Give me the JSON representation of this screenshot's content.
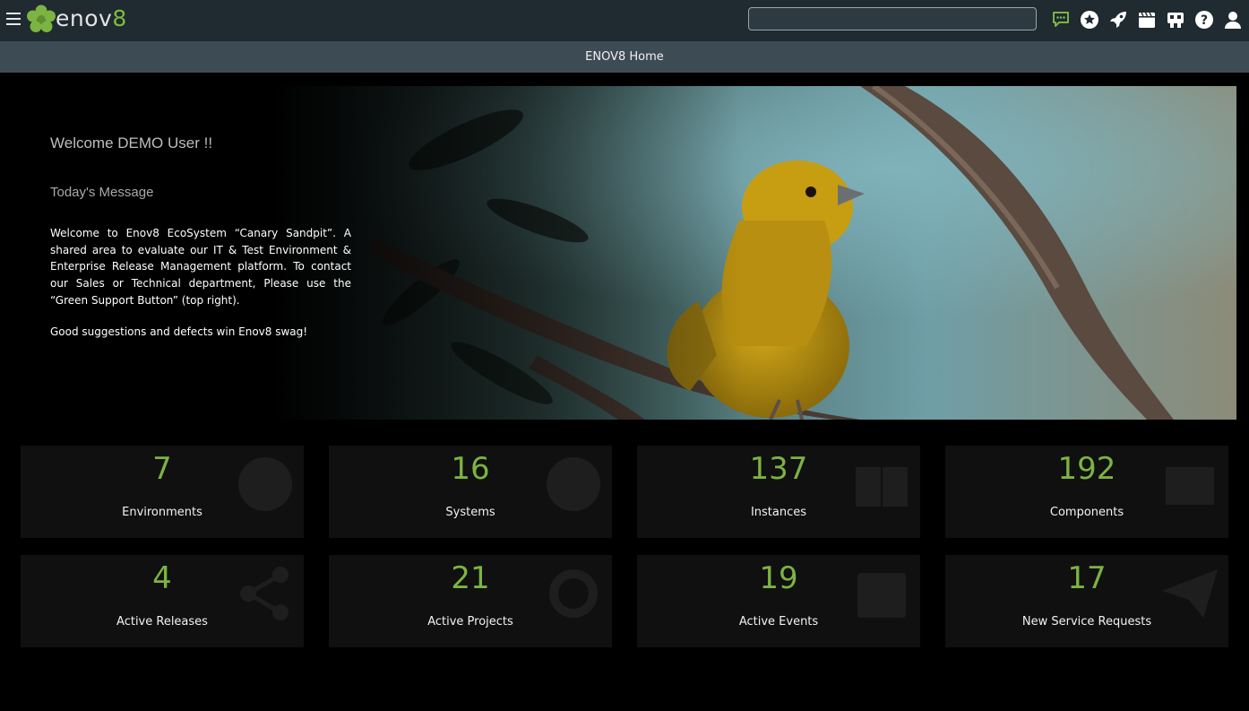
{
  "brand": {
    "name_prefix": "enov",
    "name_suffix": "8",
    "accent_color": "#7cb342"
  },
  "topbar": {
    "search": {
      "value": "",
      "placeholder": ""
    },
    "icons": [
      "support-chat-icon",
      "favorites-star-icon",
      "releases-rocket-icon",
      "events-calendar-icon",
      "apps-icon",
      "help-icon",
      "user-icon"
    ]
  },
  "subheader": {
    "title": "ENOV8 Home"
  },
  "hero": {
    "welcome": "Welcome DEMO User !!",
    "message_label": "Today's Message",
    "message": "Welcome to Enov8 EcoSystem “Canary Sandpit”. A shared area to evaluate our IT & Test Environment & Enterprise Release Management platform. To contact our Sales or Technical department, Please use the “Green Support Button” (top right).",
    "message_extra": "Good suggestions and defects win Enov8 swag!"
  },
  "stats": [
    {
      "count": "7",
      "label": "Environments",
      "icon": "globe-icon"
    },
    {
      "count": "16",
      "label": "Systems",
      "icon": "cube-icon"
    },
    {
      "count": "137",
      "label": "Instances",
      "icon": "book-icon"
    },
    {
      "count": "192",
      "label": "Components",
      "icon": "window-icon"
    },
    {
      "count": "4",
      "label": "Active Releases",
      "icon": "share-icon"
    },
    {
      "count": "21",
      "label": "Active Projects",
      "icon": "gear-icon"
    },
    {
      "count": "19",
      "label": "Active Events",
      "icon": "calendar-icon"
    },
    {
      "count": "17",
      "label": "New Service Requests",
      "icon": "paper-plane-icon"
    }
  ]
}
